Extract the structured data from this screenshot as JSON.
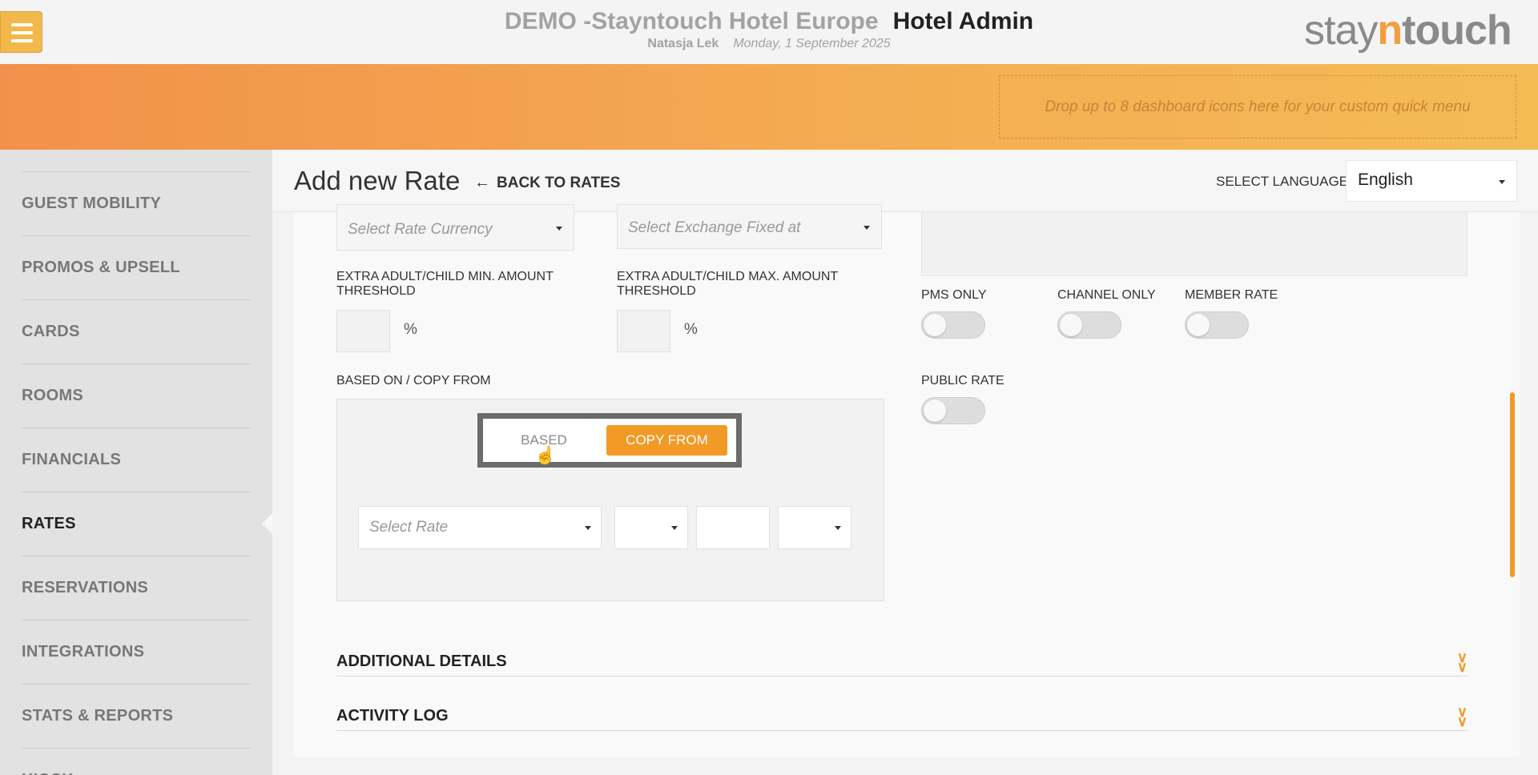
{
  "header": {
    "hotel_name": "DEMO -Stayntouch Hotel Europe",
    "app_title": "Hotel Admin",
    "user_name": "Natasja Lek",
    "date": "Monday, 1 September 2025",
    "logo": {
      "part1": "stay",
      "part2": "n",
      "part3": "touch"
    },
    "menu_icon": "hamburger-icon"
  },
  "quick_menu": {
    "placeholder": "Drop up to 8 dashboard icons here for your custom quick menu"
  },
  "sidebar": {
    "items": [
      {
        "label": "GUEST MOBILITY",
        "active": false
      },
      {
        "label": "PROMOS & UPSELL",
        "active": false
      },
      {
        "label": "CARDS",
        "active": false
      },
      {
        "label": "ROOMS",
        "active": false
      },
      {
        "label": "FINANCIALS",
        "active": false
      },
      {
        "label": "RATES",
        "active": true
      },
      {
        "label": "RESERVATIONS",
        "active": false
      },
      {
        "label": "INTEGRATIONS",
        "active": false
      },
      {
        "label": "STATS & REPORTS",
        "active": false
      },
      {
        "label": "KIOSK",
        "active": false
      }
    ]
  },
  "page": {
    "title": "Add new Rate",
    "back_label": "BACK TO RATES",
    "language_label": "SELECT LANGUAGE",
    "language_value": "English"
  },
  "form": {
    "rate_currency_placeholder": "Select Rate Currency",
    "exchange_placeholder": "Select Exchange Fixed at",
    "min_threshold_label_1": "EXTRA ADULT/CHILD MIN. AMOUNT",
    "min_threshold_label_2": "THRESHOLD",
    "max_threshold_label_1": "EXTRA ADULT/CHILD MAX. AMOUNT",
    "max_threshold_label_2": "THRESHOLD",
    "percent": "%",
    "based_copy_label": "BASED ON / COPY FROM",
    "segment": {
      "based": "BASED",
      "copy_from": "COPY FROM",
      "selected": "COPY FROM"
    },
    "select_rate_placeholder": "Select Rate",
    "toggles": [
      {
        "label": "PMS ONLY",
        "on": false
      },
      {
        "label": "CHANNEL ONLY",
        "on": false
      },
      {
        "label": "MEMBER RATE",
        "on": false
      },
      {
        "label": "PUBLIC RATE",
        "on": false
      }
    ]
  },
  "sections": {
    "additional_details": "ADDITIONAL DETAILS",
    "activity_log": "ACTIVITY LOG"
  },
  "colors": {
    "accent": "#f29a26",
    "menu_button": "#f2b84b",
    "band_start": "#f2914b",
    "band_end": "#f4bb55"
  }
}
